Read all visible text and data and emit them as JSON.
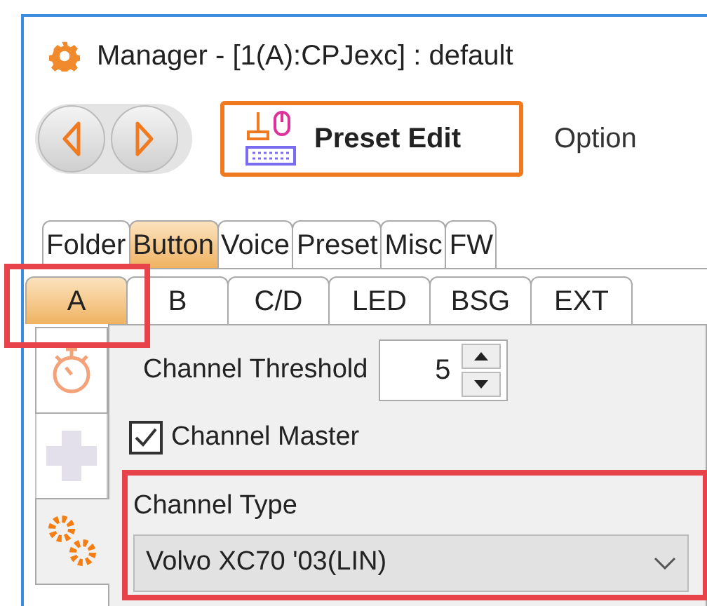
{
  "window": {
    "title": "Manager - [1(A):CPJexc] : default"
  },
  "toolbar": {
    "preset_edit": "Preset Edit",
    "option": "Option"
  },
  "tabs": [
    {
      "label": "Folder",
      "selected": false
    },
    {
      "label": "Button",
      "selected": true
    },
    {
      "label": "Voice",
      "selected": false
    },
    {
      "label": "Preset",
      "selected": false
    },
    {
      "label": "Misc",
      "selected": false
    },
    {
      "label": "FW",
      "selected": false
    }
  ],
  "sub_tabs": [
    {
      "label": "A",
      "selected": true,
      "highlighted": true
    },
    {
      "label": "B",
      "selected": false,
      "highlighted": false
    },
    {
      "label": "C/D",
      "selected": false,
      "highlighted": false
    },
    {
      "label": "LED",
      "selected": false,
      "highlighted": false
    },
    {
      "label": "BSG",
      "selected": false,
      "highlighted": false
    },
    {
      "label": "EXT",
      "selected": false,
      "highlighted": false
    }
  ],
  "side_tabs": [
    {
      "kind": "timer",
      "selected": false,
      "disabled": false
    },
    {
      "kind": "plus",
      "selected": false,
      "disabled": true
    },
    {
      "kind": "gears",
      "selected": true,
      "disabled": false
    }
  ],
  "channel_threshold": {
    "label": "Channel Threshold",
    "value": "5"
  },
  "channel_master": {
    "label": "Channel Master",
    "checked": true
  },
  "channel_type": {
    "label": "Channel Type",
    "value": "Volvo XC70 '03(LIN)",
    "highlighted": true
  }
}
